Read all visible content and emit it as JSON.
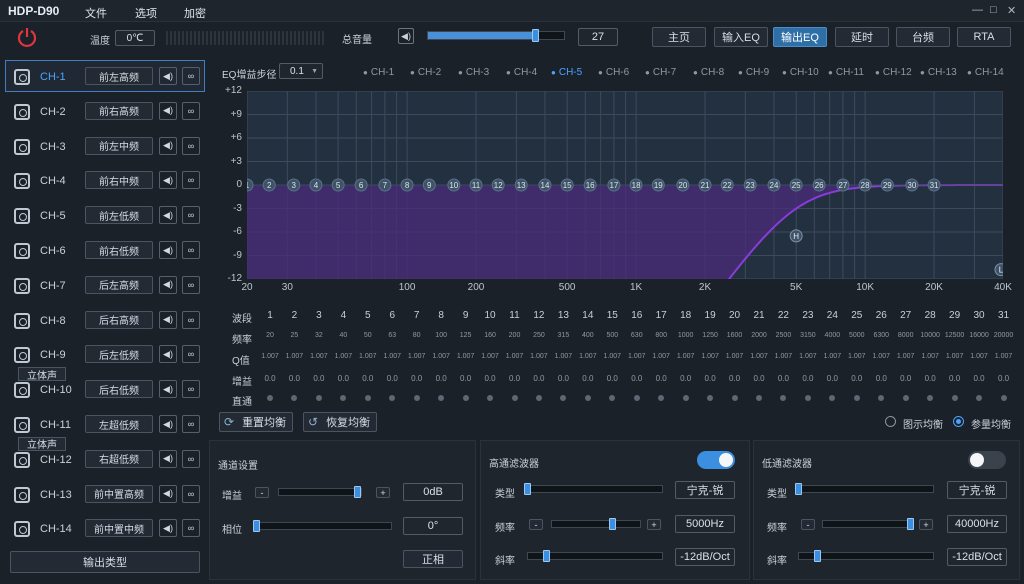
{
  "app": {
    "title": "HDP-D90"
  },
  "menu": {
    "file": "文件",
    "options": "选项",
    "encrypt": "加密"
  },
  "window": {
    "min": "—",
    "max": "□",
    "close": "✕"
  },
  "topbar": {
    "temp_label": "温度",
    "temp_value": "0℃",
    "master_label": "总音量",
    "master_value": "27",
    "master_level": 0.78,
    "tabs": [
      "主页",
      "输入EQ",
      "输出EQ",
      "延时",
      "台频",
      "RTA"
    ],
    "active_tab": 2
  },
  "channels": [
    {
      "id": "CH-1",
      "name": "前左高频"
    },
    {
      "id": "CH-2",
      "name": "前右高频"
    },
    {
      "id": "CH-3",
      "name": "前左中频"
    },
    {
      "id": "CH-4",
      "name": "前右中频"
    },
    {
      "id": "CH-5",
      "name": "前左低频"
    },
    {
      "id": "CH-6",
      "name": "前右低频"
    },
    {
      "id": "CH-7",
      "name": "后左高频"
    },
    {
      "id": "CH-8",
      "name": "后右高频"
    },
    {
      "id": "CH-9",
      "name": "后左低频"
    },
    {
      "id": "CH-10",
      "name": "后右低频"
    },
    {
      "id": "CH-11",
      "name": "左超低频"
    },
    {
      "id": "CH-12",
      "name": "右超低频"
    },
    {
      "id": "CH-13",
      "name": "前中置高频"
    },
    {
      "id": "CH-14",
      "name": "前中置中频"
    }
  ],
  "stereo_label": "立体声",
  "output_type_label": "输出类型",
  "eq": {
    "step_label": "EQ增益步径",
    "step_value": "0.1",
    "ch_tabs": [
      "CH-1",
      "CH-2",
      "CH-3",
      "CH-4",
      "CH-5",
      "CH-6",
      "CH-7",
      "CH-8",
      "CH-9",
      "CH-10",
      "CH-11",
      "CH-12",
      "CH-13",
      "CH-14"
    ],
    "active_ch_tab": 4,
    "y_ticks": [
      "+12",
      "+9",
      "+6",
      "+3",
      "0",
      "-3",
      "-6",
      "-9",
      "-12"
    ],
    "x_ticks": [
      "20",
      "30",
      "100",
      "200",
      "500",
      "1K",
      "2K",
      "5K",
      "10K",
      "20K",
      "40K"
    ],
    "bands": [
      "1",
      "2",
      "3",
      "4",
      "5",
      "6",
      "7",
      "8",
      "9",
      "10",
      "11",
      "12",
      "13",
      "14",
      "15",
      "16",
      "17",
      "18",
      "19",
      "20",
      "21",
      "22",
      "23",
      "24",
      "25",
      "26",
      "27",
      "28",
      "29",
      "30",
      "31"
    ],
    "freqs": [
      "20",
      "25",
      "32",
      "40",
      "50",
      "63",
      "80",
      "100",
      "125",
      "160",
      "200",
      "250",
      "315",
      "400",
      "500",
      "630",
      "800",
      "1000",
      "1250",
      "1600",
      "2000",
      "2500",
      "3150",
      "4000",
      "5000",
      "6300",
      "8000",
      "10000",
      "12500",
      "16000",
      "20000"
    ],
    "q_value": "1.007",
    "gain_value": "0.0",
    "row_labels": {
      "band": "波段",
      "freq": "频率",
      "q": "Q值",
      "gain": "增益",
      "bypass": "直通"
    },
    "highpass_marker": "H",
    "lowpass_marker": "L",
    "reset_label": "重置均衡",
    "restore_label": "恢复均衡",
    "graphic_label": "图示均衡",
    "param_label": "参量均衡"
  },
  "channel_settings": {
    "title": "通道设置",
    "gain_label": "增益",
    "gain_value": "0dB",
    "gain_level": 0.94,
    "phase_label": "相位",
    "phase_value": "0°",
    "phase_level": 0.0,
    "polarity_label": "正相",
    "minus": "-",
    "plus": "+"
  },
  "highpass": {
    "title": "高通滤波器",
    "enabled": true,
    "type_label": "类型",
    "type_value": "宁克-锐",
    "freq_label": "频率",
    "freq_value": "5000Hz",
    "freq_level": 0.68,
    "slope_label": "斜率",
    "slope_value": "-12dB/Oct",
    "type_level": 0.0,
    "slope_level": 0.14
  },
  "lowpass": {
    "title": "低通滤波器",
    "enabled": false,
    "type_label": "类型",
    "type_value": "宁克-锐",
    "freq_label": "频率",
    "freq_value": "40000Hz",
    "freq_level": 0.98,
    "slope_label": "斜率",
    "slope_value": "-12dB/Oct",
    "type_level": 0.0,
    "slope_level": 0.14
  },
  "colors": {
    "accent": "#3b8ee0",
    "fill": "#4b2a7a",
    "curve": "#8a3bdc",
    "power": "#e0353f"
  }
}
